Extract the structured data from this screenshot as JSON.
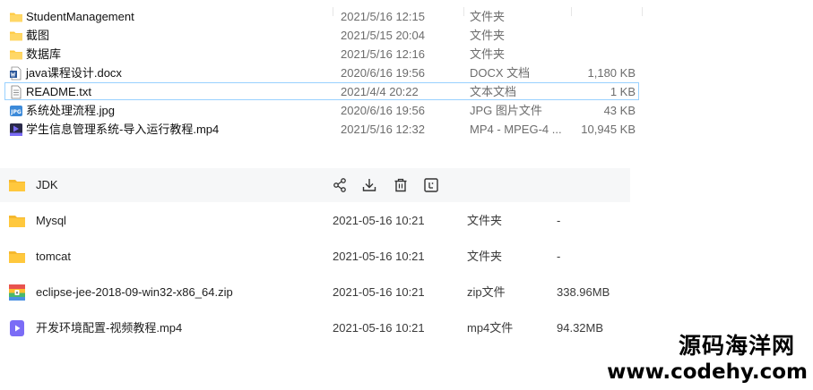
{
  "explorer": {
    "rows": [
      {
        "name": "StudentManagement",
        "date": "2021/5/16 12:15",
        "type": "文件夹",
        "size": "",
        "icon": "folder-icon"
      },
      {
        "name": "截图",
        "date": "2021/5/15 20:04",
        "type": "文件夹",
        "size": "",
        "icon": "folder-icon"
      },
      {
        "name": "数据库",
        "date": "2021/5/16 12:16",
        "type": "文件夹",
        "size": "",
        "icon": "folder-icon"
      },
      {
        "name": "java课程设计.docx",
        "date": "2020/6/16 19:56",
        "type": "DOCX 文档",
        "size": "1,180 KB",
        "icon": "word-doc-icon"
      },
      {
        "name": "README.txt",
        "date": "2021/4/4 20:22",
        "type": "文本文档",
        "size": "1 KB",
        "icon": "text-file-icon"
      },
      {
        "name": "系统处理流程.jpg",
        "date": "2020/6/16 19:56",
        "type": "JPG 图片文件",
        "size": "43 KB",
        "icon": "jpg-image-icon"
      },
      {
        "name": "学生信息管理系统-导入运行教程.mp4",
        "date": "2021/5/16 12:32",
        "type": "MP4 - MPEG-4 ...",
        "size": "10,945 KB",
        "icon": "mp4-video-icon"
      }
    ]
  },
  "cloud": {
    "rows": [
      {
        "name": "JDK",
        "date": "",
        "type": "",
        "size": "",
        "icon": "folder-icon"
      },
      {
        "name": "Mysql",
        "date": "2021-05-16 10:21",
        "type": "文件夹",
        "size": "-",
        "icon": "folder-icon"
      },
      {
        "name": "tomcat",
        "date": "2021-05-16 10:21",
        "type": "文件夹",
        "size": "-",
        "icon": "folder-icon"
      },
      {
        "name": "eclipse-jee-2018-09-win32-x86_64.zip",
        "date": "2021-05-16 10:21",
        "type": "zip文件",
        "size": "338.96MB",
        "icon": "zip-archive-icon"
      },
      {
        "name": "开发环境配置-视频教程.mp4",
        "date": "2021-05-16 10:21",
        "type": "mp4文件",
        "size": "94.32MB",
        "icon": "video-file-icon"
      }
    ],
    "hover_actions": [
      "share-icon",
      "download-icon",
      "delete-icon",
      "more-icon"
    ]
  },
  "watermark": {
    "line1": "源码海洋网",
    "line2": "www.codehy.com"
  },
  "colors": {
    "folder": "#ffc83d",
    "selection_border": "#99d1ff",
    "word": "#2b579a",
    "jpg": "#3c8ad9",
    "video": "#7b6cf6",
    "zip_red": "#e8534f",
    "zip_yellow": "#ffbe2e",
    "zip_green": "#49b86b",
    "zip_blue": "#4a90e2"
  }
}
